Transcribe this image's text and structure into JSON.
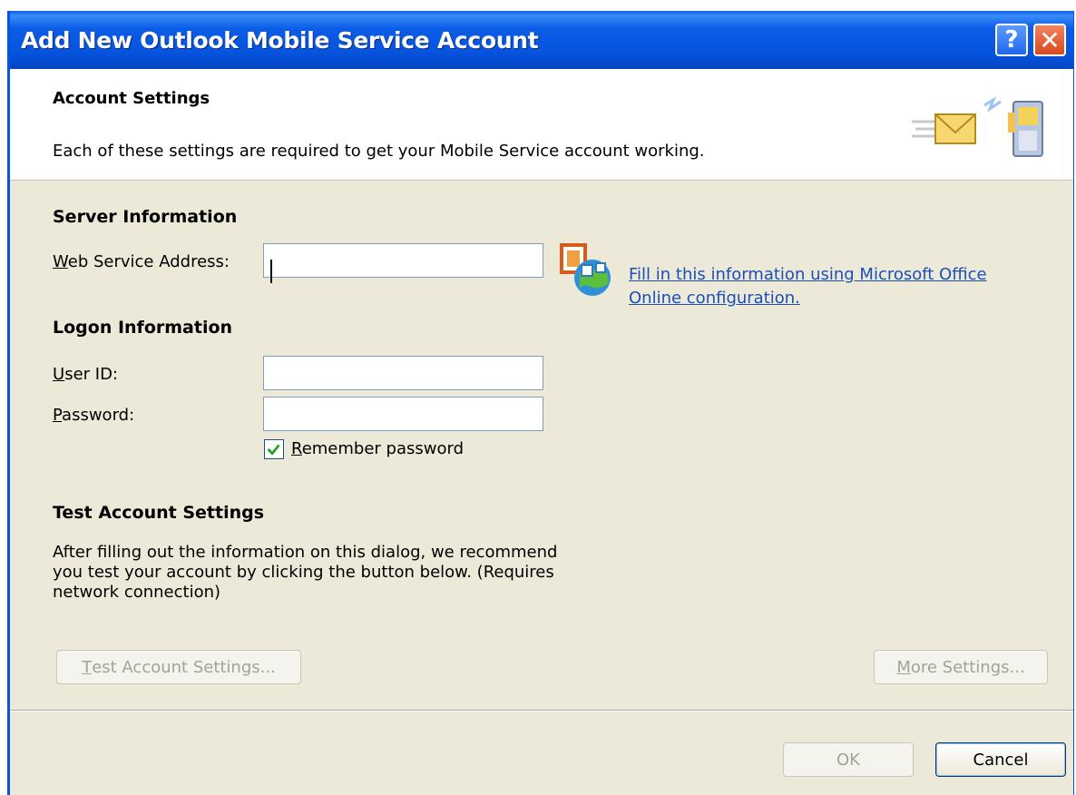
{
  "window": {
    "title": "Add New Outlook Mobile Service Account",
    "help_label": "?",
    "close_label": "✕"
  },
  "header": {
    "title": "Account Settings",
    "description": "Each of these settings are required to get your Mobile Service account working.",
    "icon": "mail-to-mobile-icon"
  },
  "server": {
    "heading": "Server Information",
    "web_service_label_accel": "W",
    "web_service_label_rest": "eb Service Address:",
    "web_service_value": "",
    "online_icon": "office-online-icon",
    "link_text": "Fill in this information using Microsoft Office Online configuration."
  },
  "logon": {
    "heading": "Logon Information",
    "user_id_accel": "U",
    "user_id_rest": "ser ID:",
    "user_id_value": "",
    "password_accel": "P",
    "password_rest": "assword:",
    "password_value": "",
    "remember_accel": "R",
    "remember_rest": "emember password",
    "remember_checked": true
  },
  "test": {
    "heading": "Test Account Settings",
    "description": "After filling out the information on this dialog, we recommend you test your account by clicking the button below. (Requires network connection)",
    "test_button_accel": "T",
    "test_button_rest": "est Account Settings...",
    "more_button_accel": "M",
    "more_button_rest": "ore Settings..."
  },
  "footer": {
    "ok_label": "OK",
    "cancel_label": "Cancel"
  },
  "colors": {
    "titlebar": "#0653dc",
    "dialog_bg": "#ece9d8",
    "link": "#1b4fb5"
  }
}
